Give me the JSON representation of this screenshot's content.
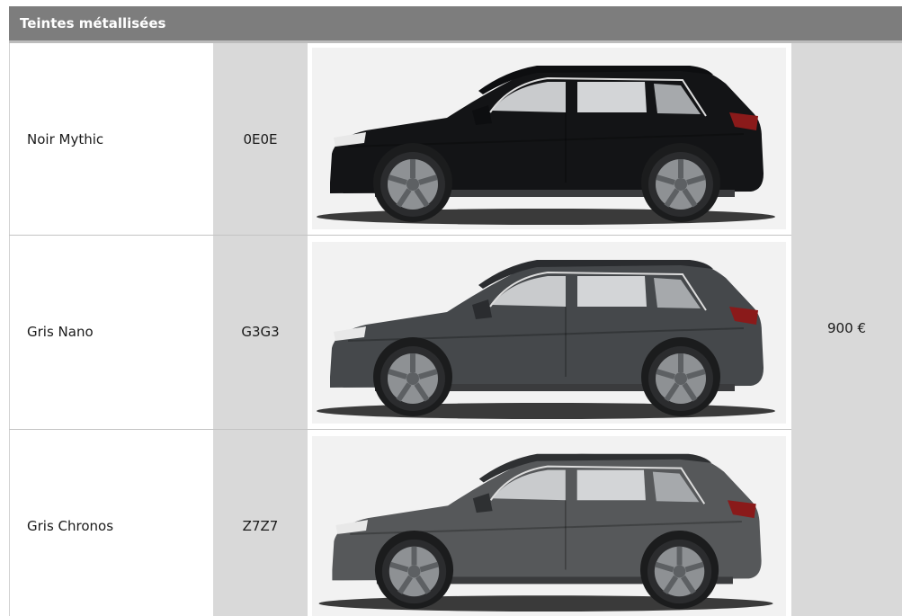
{
  "table": {
    "header": "Teintes métallisées",
    "price": "900 €",
    "rows": [
      {
        "name": "Noir Mythic",
        "code": "0E0E",
        "body_color": "#131416",
        "roof_color": "#0d0e10"
      },
      {
        "name": "Gris Nano",
        "code": "G3G3",
        "body_color": "#45484b",
        "roof_color": "#2a2c2f"
      },
      {
        "name": "Gris Chronos",
        "code": "Z7Z7",
        "body_color": "#56585a",
        "roof_color": "#2e3032"
      }
    ]
  }
}
